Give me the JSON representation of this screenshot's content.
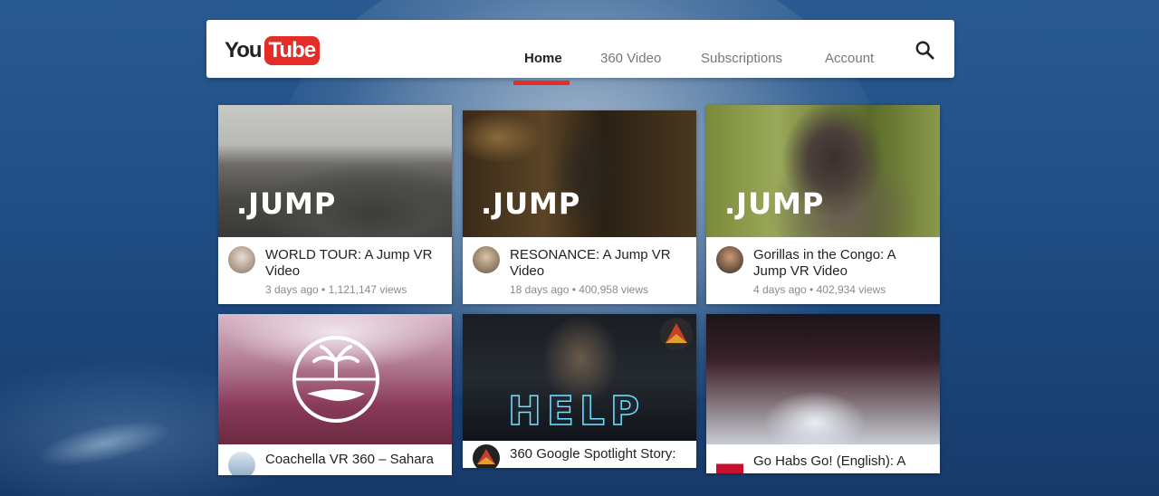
{
  "header": {
    "logo_you": "You",
    "logo_tube": "Tube",
    "nav": [
      {
        "label": "Home",
        "active": true
      },
      {
        "label": "360 Video",
        "active": false
      },
      {
        "label": "Subscriptions",
        "active": false
      },
      {
        "label": "Account",
        "active": false
      }
    ]
  },
  "colors": {
    "accent": "#e52d27"
  },
  "cards": [
    {
      "overlay": ".JUMP",
      "title": "WORLD TOUR: A Jump VR Video",
      "age": "3 days ago",
      "views": "1,121,147 views"
    },
    {
      "overlay": ".JUMP",
      "title": "RESONANCE: A Jump VR Video",
      "age": "18 days ago",
      "views": "400,958 views"
    },
    {
      "overlay": ".JUMP",
      "title": "Gorillas in the Congo: A Jump VR Video",
      "age": "4 days ago",
      "views": "402,934 views"
    },
    {
      "overlay": "",
      "title": "Coachella VR 360 – Sahara",
      "age": "",
      "views": ""
    },
    {
      "overlay": "HELP",
      "title": "360 Google Spotlight Story:",
      "age": "",
      "views": ""
    },
    {
      "overlay": "",
      "title": "Go Habs Go! (English): A",
      "age": "",
      "views": ""
    }
  ],
  "separator": " • "
}
